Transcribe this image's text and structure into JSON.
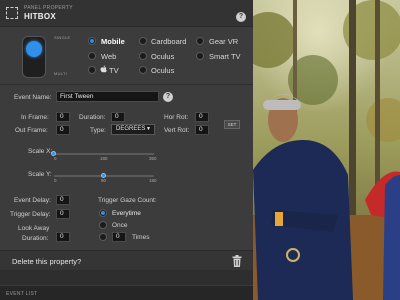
{
  "header": {
    "kicker": "PANEL PROPERTY",
    "title": "HITBOX",
    "help": "?"
  },
  "toggle": {
    "top_label": "SINGLE",
    "bottom_label": "MULTI",
    "state": "single"
  },
  "platforms": [
    {
      "label": "Mobile",
      "selected": true,
      "apple": false
    },
    {
      "label": "Cardboard",
      "selected": false,
      "apple": false
    },
    {
      "label": "Gear VR",
      "selected": false,
      "apple": false
    },
    {
      "label": "Web",
      "selected": false,
      "apple": false
    },
    {
      "label": "Oculus",
      "selected": false,
      "apple": false
    },
    {
      "label": "Smart TV",
      "selected": false,
      "apple": false
    },
    {
      "label": "TV",
      "selected": false,
      "apple": true
    },
    {
      "label": "Oculus",
      "selected": false,
      "apple": false
    }
  ],
  "event": {
    "name_label": "Event Name:",
    "name_value": "First Tween",
    "help": "?"
  },
  "timing": {
    "in_frame_label": "In Frame:",
    "in_frame_value": "0",
    "duration_label": "Duration:",
    "duration_value": "0",
    "out_frame_label": "Out Frame:",
    "out_frame_value": "0",
    "type_label": "Type:",
    "type_value": "DEGREES",
    "hor_rot_label": "Hor Rot:",
    "hor_rot_value": "0",
    "vert_rot_label": "Vert Rot:",
    "vert_rot_value": "0",
    "set_label": "SET"
  },
  "scale_x": {
    "label": "Scale X:",
    "min": "0",
    "mid": "180",
    "max": "360",
    "value": 0
  },
  "scale_y": {
    "label": "Scale Y:",
    "min": "0",
    "mid": "90",
    "max": "180",
    "value": 90
  },
  "delays": {
    "event_delay_label": "Event Delay:",
    "event_delay_value": "0",
    "trigger_delay_label": "Trigger Delay:",
    "trigger_delay_value": "0",
    "look_away_label_1": "Look Away",
    "look_away_label_2": "Duration:",
    "look_away_value": "0"
  },
  "gaze": {
    "label": "Trigger Gaze Count:",
    "option_everytime": "Everytime",
    "option_once": "Once",
    "times_value": "0",
    "times_label": "Times",
    "selected": "everytime"
  },
  "footer": {
    "delete_label": "Delete this property?",
    "event_list_label": "EVENT LIST"
  },
  "colors": {
    "accent": "#2f8fe9",
    "panel_bg": "#3c3c3c"
  }
}
